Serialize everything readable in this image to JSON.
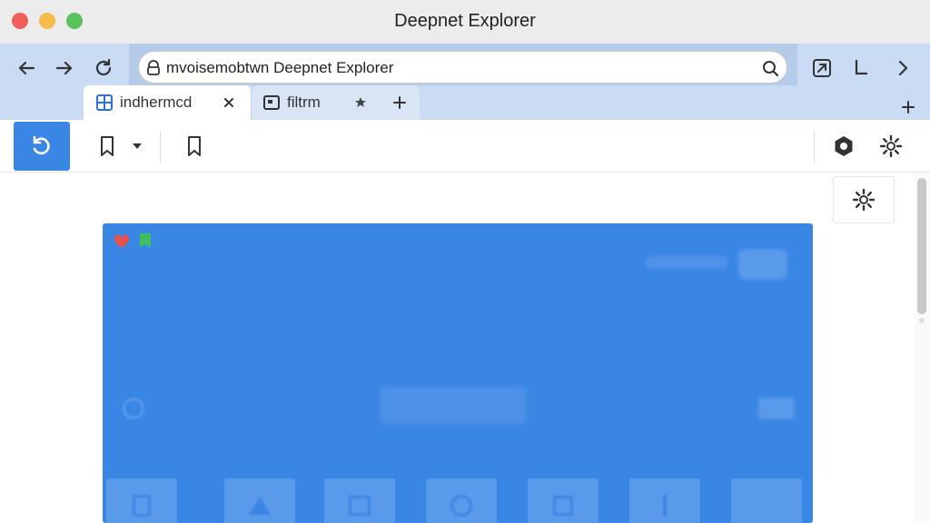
{
  "window": {
    "title": "Deepnet Explorer"
  },
  "address_bar": {
    "url": "mvoisemobtwn Deepnet Explorer"
  },
  "tabs": [
    {
      "label": "indhermcd",
      "icon": "grid-icon",
      "active": true
    },
    {
      "label": "filtrm",
      "icon": "image-icon",
      "active": false
    }
  ],
  "toolbar": {
    "primary_action": "undo-icon"
  },
  "content": {
    "panel_color": "#3a86e5",
    "tile_icons": [
      "phone-icon",
      "triangle-icon",
      "frame-icon",
      "circle-icon",
      "square-icon",
      "line-icon",
      "blank-icon"
    ]
  }
}
